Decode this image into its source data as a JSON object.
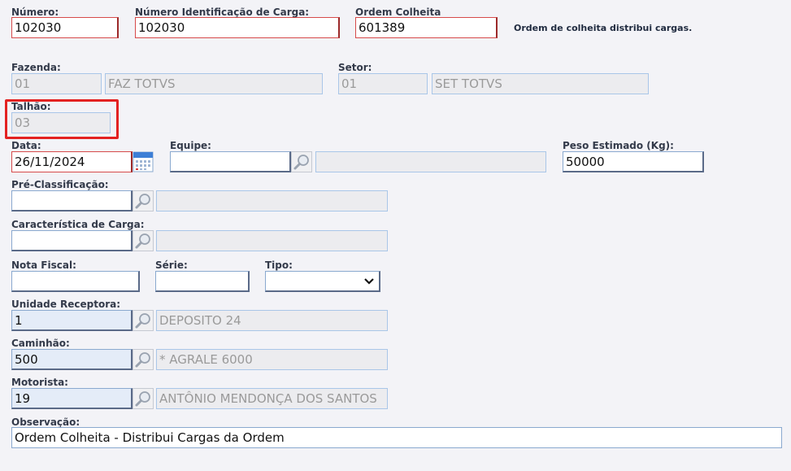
{
  "numero": {
    "label": "Número:",
    "value": "102030"
  },
  "num_ident_carga": {
    "label": "Número Identificação de Carga:",
    "value": "102030"
  },
  "ordem_colheita": {
    "label": "Ordem Colheita",
    "value": "601389",
    "note": "Ordem de colheita distribui cargas."
  },
  "fazenda": {
    "label": "Fazenda:",
    "code": "01",
    "desc": "FAZ TOTVS"
  },
  "setor": {
    "label": "Setor:",
    "code": "01",
    "desc": "SET TOTVS"
  },
  "talhao": {
    "label": "Talhão:",
    "value": "03"
  },
  "data": {
    "label": "Data:",
    "value": "26/11/2024"
  },
  "equipe": {
    "label": "Equipe:",
    "code": "",
    "desc": ""
  },
  "peso_estimado": {
    "label": "Peso Estimado (Kg):",
    "value": "50000"
  },
  "pre_classificacao": {
    "label": "Pré-Classificação:",
    "code": "",
    "desc": ""
  },
  "caracteristica_carga": {
    "label": "Característica de Carga:",
    "code": "",
    "desc": ""
  },
  "nota_fiscal": {
    "label": "Nota Fiscal:",
    "value": ""
  },
  "serie": {
    "label": "Série:",
    "value": ""
  },
  "tipo": {
    "label": "Tipo:",
    "value": ""
  },
  "unidade_receptora": {
    "label": "Unidade Receptora:",
    "code": "1",
    "desc": "DEPOSITO 24"
  },
  "caminhao": {
    "label": "Caminhão:",
    "code": "500",
    "desc": "* AGRALE 6000"
  },
  "motorista": {
    "label": "Motorista:",
    "code": "19",
    "desc": "ANTÔNIO MENDONÇA DOS SANTOS"
  },
  "observacao": {
    "label": "Observação:",
    "value": "Ordem Colheita - Distribui Cargas da Ordem"
  },
  "colors": {
    "required_border": "#d64a4a",
    "highlight": "#e32222",
    "disabled_bg": "#ececef",
    "key_bg": "#e4ecf8"
  }
}
